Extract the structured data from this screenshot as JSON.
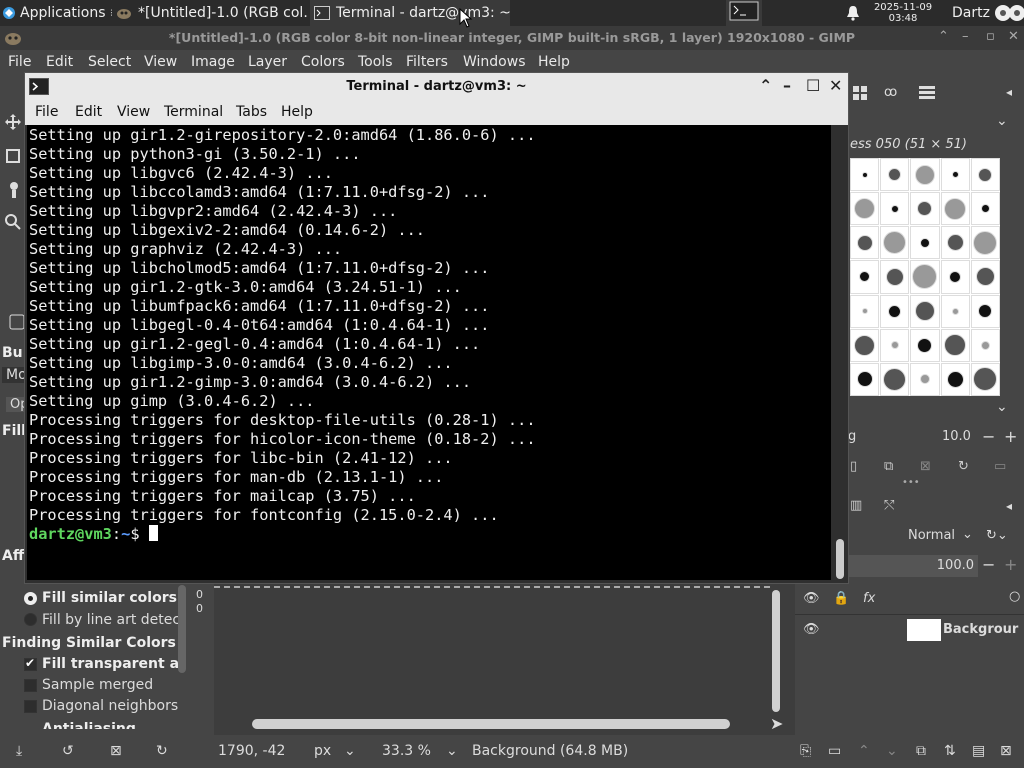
{
  "taskbar": {
    "apps_label": "Applications",
    "tasks": [
      {
        "label": "*[Untitled]-1.0 (RGB col..."
      },
      {
        "label": "Terminal - dartz@vm3: ~"
      }
    ],
    "clock_date": "2025-11-09",
    "clock_time": "03:48",
    "user": "Dartz"
  },
  "gimp": {
    "title": "*[Untitled]-1.0 (RGB color 8-bit non-linear integer, GIMP built-in sRGB, 1 layer) 1920x1080 - GIMP",
    "menu": [
      "File",
      "Edit",
      "Select",
      "View",
      "Image",
      "Layer",
      "Colors",
      "Tools",
      "Filters",
      "Windows",
      "Help"
    ],
    "left_panel": {
      "bu": "Bu",
      "mo": "Mo",
      "op": "Op",
      "fill": "Fill",
      "aff": "Aff",
      "fill_similar": "Fill similar colors",
      "fill_line_art": "Fill by line art detect",
      "finding_header": "Finding Similar Colors",
      "fill_transparent": "Fill transparent a",
      "sample_merged": "Sample merged",
      "diagonal": "Diagonal neighbors",
      "antialiasing": "Antialiasing"
    },
    "brushes": {
      "title": "ess 050 (51 × 51)",
      "spacing_label": "g",
      "spacing_value": "10.0"
    },
    "layers": {
      "mode": "Normal",
      "opacity": "100.0",
      "layer_name": "Backgrour"
    },
    "ruler": {
      "zero": "0"
    },
    "statusbar": {
      "coords": "1790, -42",
      "unit": "px",
      "zoom": "33.3 %",
      "info": "Background (64.8 MB)"
    }
  },
  "terminal": {
    "title": "Terminal - dartz@vm3: ~",
    "menu": [
      "File",
      "Edit",
      "View",
      "Terminal",
      "Tabs",
      "Help"
    ],
    "lines": [
      "Setting up gir1.2-girepository-2.0:amd64 (1.86.0-6) ...",
      "Setting up python3-gi (3.50.2-1) ...",
      "Setting up libgvc6 (2.42.4-3) ...",
      "Setting up libccolamd3:amd64 (1:7.11.0+dfsg-2) ...",
      "Setting up libgvpr2:amd64 (2.42.4-3) ...",
      "Setting up libgexiv2-2:amd64 (0.14.6-2) ...",
      "Setting up graphviz (2.42.4-3) ...",
      "Setting up libcholmod5:amd64 (1:7.11.0+dfsg-2) ...",
      "Setting up gir1.2-gtk-3.0:amd64 (3.24.51-1) ...",
      "Setting up libumfpack6:amd64 (1:7.11.0+dfsg-2) ...",
      "Setting up libgegl-0.4-0t64:amd64 (1:0.4.64-1) ...",
      "Setting up gir1.2-gegl-0.4:amd64 (1:0.4.64-1) ...",
      "Setting up libgimp-3.0-0:amd64 (3.0.4-6.2) ...",
      "Setting up gir1.2-gimp-3.0:amd64 (3.0.4-6.2) ...",
      "Setting up gimp (3.0.4-6.2) ...",
      "Processing triggers for desktop-file-utils (0.28-1) ...",
      "Processing triggers for hicolor-icon-theme (0.18-2) ...",
      "Processing triggers for libc-bin (2.41-12) ...",
      "Processing triggers for man-db (2.13.1-1) ...",
      "Processing triggers for mailcap (3.75) ...",
      "Processing triggers for fontconfig (2.15.0-2.4) ..."
    ],
    "prompt_user": "dartz@vm3",
    "prompt_sep": ":",
    "prompt_path": "~",
    "prompt_symbol": "$"
  }
}
